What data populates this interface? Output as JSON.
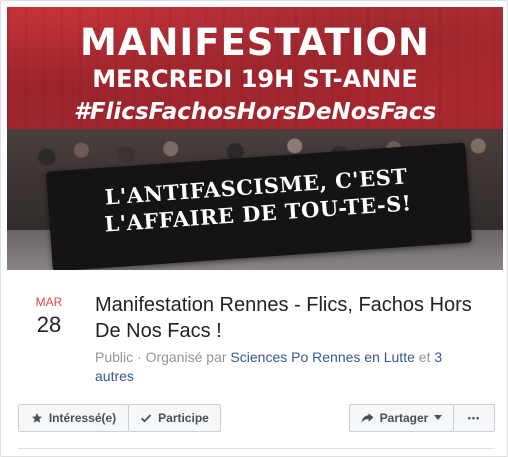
{
  "cover": {
    "title_line1": "MANIFESTATION",
    "title_line2": "MERCREDI 19H ST-ANNE",
    "title_line3": "#FlicsFachosHorsDeNosFacs",
    "banner_line1": "L'ANTIFASCISME, C'EST",
    "banner_line2": "L'AFFAIRE DE TOU-TE-S!"
  },
  "event": {
    "month": "MAR",
    "day": "28",
    "title": "Manifestation Rennes - Flics, Fachos Hors De Nos Facs !",
    "visibility": "Public",
    "separator": " · ",
    "organized_prefix": "Organisé par ",
    "organizer": "Sciences Po Rennes en Lutte",
    "and": " et ",
    "others": "3 autres"
  },
  "actions": {
    "interested_label": "Intéressé(e)",
    "participate_label": "Participe",
    "share_label": "Partager",
    "more_label": "•••"
  },
  "icons": {
    "interested": "star-icon",
    "participate": "check-icon",
    "share": "share-arrow-icon",
    "dropdown": "caret-down-icon"
  },
  "colors": {
    "date_month": "#e0454f",
    "link": "#365899",
    "cover_red": "#c3323a"
  }
}
